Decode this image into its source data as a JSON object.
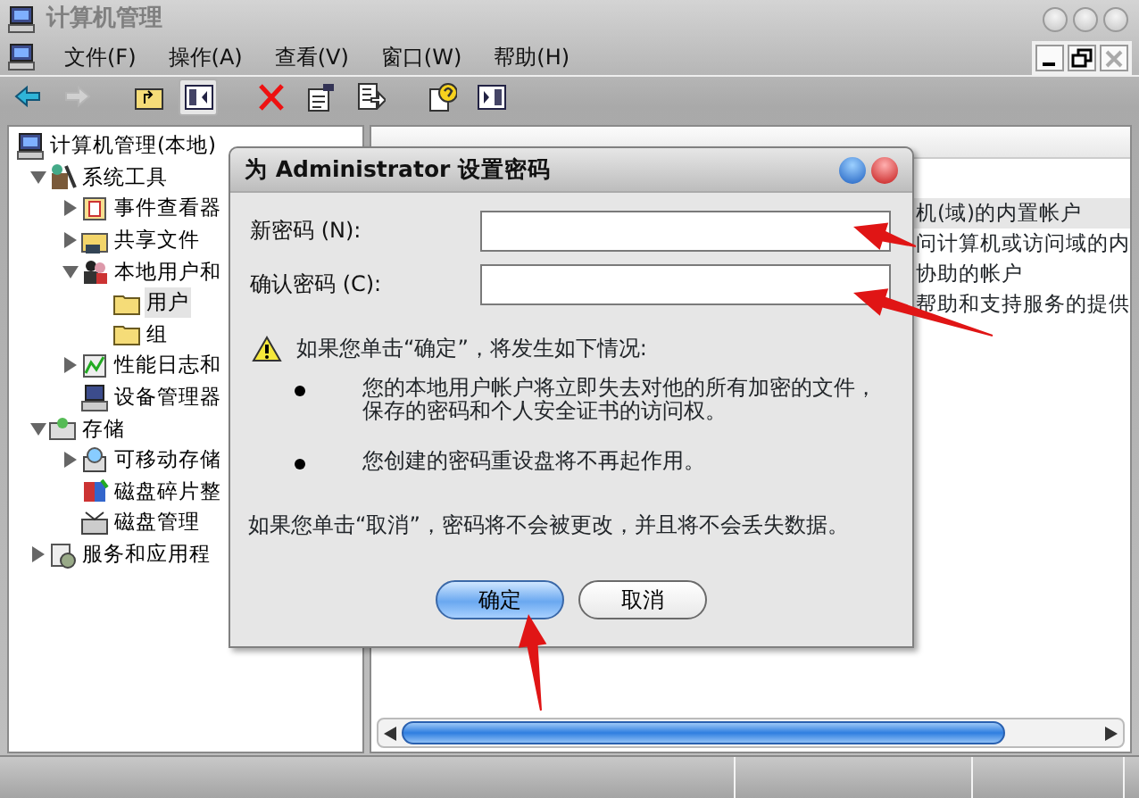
{
  "window": {
    "title": "计算机管理"
  },
  "menu": [
    "文件(F)",
    "操作(A)",
    "查看(V)",
    "窗口(W)",
    "帮助(H)"
  ],
  "toolbar": [
    {
      "kind": "back",
      "disabled": false,
      "pressed": false
    },
    {
      "kind": "forward",
      "disabled": true,
      "pressed": false
    },
    {
      "kind": "up",
      "disabled": false,
      "pressed": false
    },
    {
      "kind": "tree",
      "disabled": false,
      "pressed": true
    },
    {
      "kind": "delete",
      "disabled": false,
      "pressed": false
    },
    {
      "kind": "properties",
      "disabled": false,
      "pressed": false
    },
    {
      "kind": "export",
      "disabled": false,
      "pressed": false
    },
    {
      "kind": "help",
      "disabled": false,
      "pressed": false
    },
    {
      "kind": "panel",
      "disabled": false,
      "pressed": false
    }
  ],
  "tree": [
    {
      "label": "计算机管理(本地)",
      "kind": "computer",
      "selected": false,
      "children": [
        {
          "label": "系统工具",
          "kind": "tools",
          "expanded": true,
          "selected": false,
          "children": [
            {
              "label": "事件查看器",
              "kind": "log",
              "expanded": false,
              "selected": false
            },
            {
              "label": "共享文件",
              "kind": "share",
              "expanded": false,
              "selected": false
            },
            {
              "label": "本地用户和",
              "kind": "users",
              "expanded": true,
              "selected": false,
              "children": [
                {
                  "label": "用户",
                  "kind": "folder",
                  "selected": true
                },
                {
                  "label": "组",
                  "kind": "folder",
                  "selected": false
                }
              ]
            },
            {
              "label": "性能日志和",
              "kind": "perf",
              "expanded": false,
              "selected": false
            },
            {
              "label": "设备管理器",
              "kind": "device",
              "selected": false
            }
          ]
        },
        {
          "label": "存储",
          "kind": "storage",
          "expanded": true,
          "selected": false,
          "children": [
            {
              "label": "可移动存储",
              "kind": "removable",
              "expanded": false,
              "selected": false
            },
            {
              "label": "磁盘碎片整",
              "kind": "defrag",
              "selected": false
            },
            {
              "label": "磁盘管理",
              "kind": "disk",
              "selected": false
            }
          ]
        },
        {
          "label": "服务和应用程",
          "kind": "services",
          "expanded": false,
          "selected": false
        }
      ]
    }
  ],
  "list": {
    "rows": [
      {
        "description": "机(域)的内置帐户",
        "selected": true
      },
      {
        "description": "问计算机或访问域的内",
        "selected": false
      },
      {
        "description": "协助的帐户",
        "selected": false
      },
      {
        "description": "帮助和支持服务的提供",
        "selected": false
      }
    ]
  },
  "dialog": {
    "title": "为 Administrator 设置密码",
    "fields": [
      {
        "label": "新密码 (N):"
      },
      {
        "label": "确认密码 (C):"
      }
    ],
    "warning": "如果您单击“确定”，将发生如下情况:",
    "bullets": [
      "您的本地用户帐户将立即失去对他的所有加密的文件，保存的密码和个人安全证书的访问权。",
      "您创建的密码重设盘将不再起作用。"
    ],
    "note": "如果您单击“取消”，密码将不会被更改，并且将不会丢失数据。",
    "buttons": [
      {
        "label": "确定",
        "default": true
      },
      {
        "label": "取消",
        "default": false
      }
    ]
  }
}
